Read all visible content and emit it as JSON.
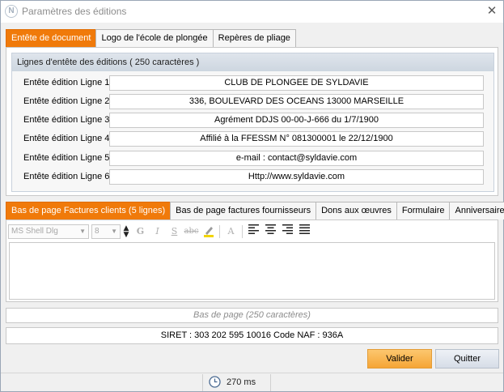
{
  "window": {
    "title": "Paramètres des éditions",
    "close_glyph": "✕",
    "app_icon_letter": "N"
  },
  "top_tabs": [
    {
      "label": "Entête de document",
      "active": true
    },
    {
      "label": "Logo de l'école de plongée",
      "active": false
    },
    {
      "label": "Repères de pliage",
      "active": false
    }
  ],
  "header_group": {
    "title": "Lignes d'entête des éditions ( 250 caractères )",
    "lines": [
      {
        "label": "Entête édition Ligne 1",
        "value": "CLUB DE PLONGEE DE SYLDAVIE"
      },
      {
        "label": "Entête édition Ligne 2",
        "value": "336, BOULEVARD DES OCEANS 13000 MARSEILLE"
      },
      {
        "label": "Entête édition Ligne 3",
        "value": "Agrément DDJS 00-00-J-666 du 1/7/1900"
      },
      {
        "label": "Entête édition Ligne 4",
        "value": "Affilié à la FFESSM N° 081300001 le 22/12/1900"
      },
      {
        "label": "Entête édition Ligne 5",
        "value": "e-mail : contact@syldavie.com"
      },
      {
        "label": "Entête édition Ligne 6",
        "value": "Http://www.syldavie.com"
      }
    ]
  },
  "bottom_tabs": [
    {
      "label": "Bas de page Factures clients (5 lignes)",
      "active": true
    },
    {
      "label": "Bas de page factures fournisseurs",
      "active": false
    },
    {
      "label": "Dons aux œuvres",
      "active": false
    },
    {
      "label": "Formulaire",
      "active": false
    },
    {
      "label": "Anniversaires",
      "active": false
    }
  ],
  "toolbar": {
    "font_name": "MS Shell Dlg",
    "font_size": "8",
    "bold": "G",
    "italic": "I",
    "underline": "S",
    "strike": "abc",
    "font_letter": "A"
  },
  "editor": {
    "content": ""
  },
  "footer_caption": "Bas de page (250 caractères)",
  "siret_line": "SIRET : 303 202 595 10016 Code NAF : 936A",
  "buttons": {
    "ok": "Valider",
    "quit": "Quitter"
  },
  "status": {
    "timing": "270 ms"
  },
  "colors": {
    "accent_tab": "#f07a0a",
    "ok_button": "#f5a536",
    "quit_button": "#d6dde7"
  }
}
